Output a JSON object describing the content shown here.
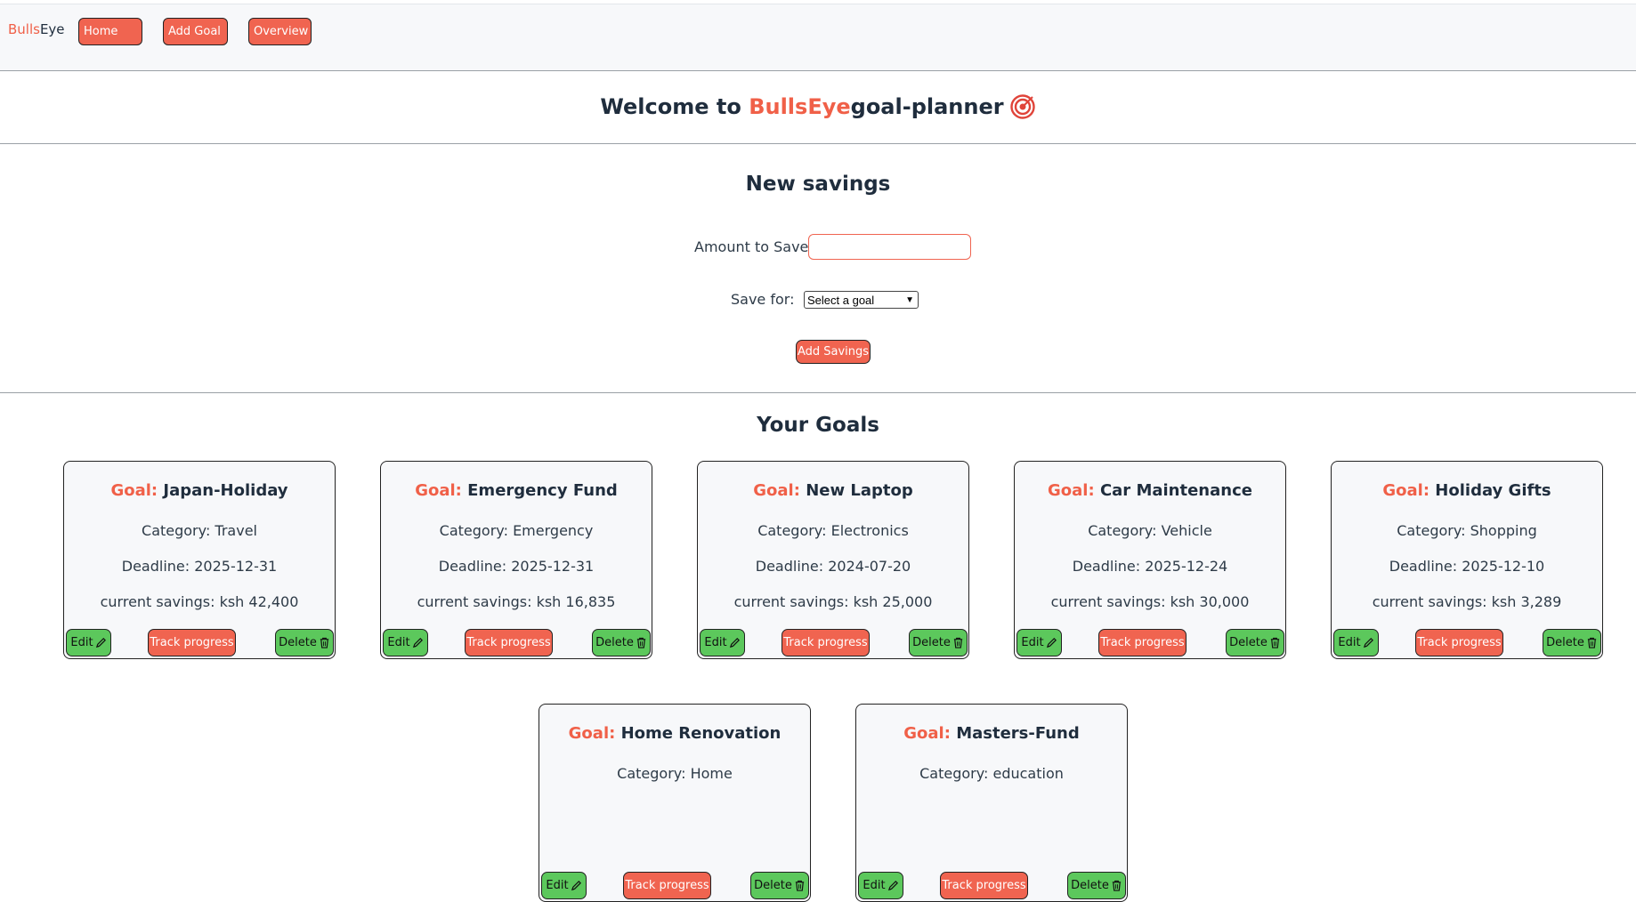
{
  "nav": {
    "brand_part1": "Bulls",
    "brand_part2": "Eye",
    "links": [
      "Home",
      "Add Goal",
      "Overview"
    ]
  },
  "welcome": {
    "prefix": "Welcome to ",
    "brand": "BullsEye",
    "suffix": "goal-planner",
    "icon": "target-icon"
  },
  "savings_form": {
    "heading": "New savings",
    "amount_label": "Amount to Save:",
    "amount_value": "",
    "save_for_label": "Save for:",
    "save_for_selected": "Select a goal",
    "submit_label": "Add Savings"
  },
  "goals_section": {
    "heading": "Your Goals",
    "goal_prefix": "Goal:",
    "edit_label": "Edit",
    "track_label": "Track progress",
    "delete_label": "Delete",
    "goals": [
      {
        "name": "Japan-Holiday",
        "category": "Category: Travel",
        "deadline": "Deadline: 2025-12-31",
        "savings": "current savings: ksh 42,400"
      },
      {
        "name": "Emergency Fund",
        "category": "Category: Emergency",
        "deadline": "Deadline: 2025-12-31",
        "savings": "current savings: ksh 16,835"
      },
      {
        "name": "New Laptop",
        "category": "Category: Electronics",
        "deadline": "Deadline: 2024-07-20",
        "savings": "current savings: ksh 25,000"
      },
      {
        "name": "Car Maintenance",
        "category": "Category: Vehicle",
        "deadline": "Deadline: 2025-12-24",
        "savings": "current savings: ksh 30,000"
      },
      {
        "name": "Holiday Gifts",
        "category": "Category: Shopping",
        "deadline": "Deadline: 2025-12-10",
        "savings": "current savings: ksh 3,289"
      },
      {
        "name": "Home Renovation",
        "category": "Category: Home",
        "deadline": "",
        "savings": ""
      },
      {
        "name": "Masters-Fund",
        "category": "Category: education",
        "deadline": "",
        "savings": ""
      }
    ]
  },
  "colors": {
    "accent": "#f06450",
    "green": "#5cc85c",
    "text": "#1f2d3d"
  }
}
